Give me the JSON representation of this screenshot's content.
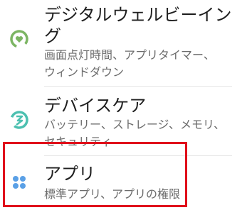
{
  "settings_list": {
    "items": [
      {
        "title": "デジタルウェルビーイング",
        "subtitle_lines": [
          "画面点灯時間、アプリタイマー、",
          "ウィンドダウン"
        ],
        "icon": "digital-wellbeing-icon",
        "icon_color": "#7cb563"
      },
      {
        "title": "デバイスケア",
        "subtitle_lines": [
          "バッテリー、ストレージ、メモリ、",
          "セキュリティ"
        ],
        "icon": "device-care-icon",
        "icon_color": "#4cc0b0"
      },
      {
        "title": "アプリ",
        "subtitle_lines": [
          "標準アプリ、アプリの権限"
        ],
        "icon": "apps-icon",
        "icon_color": "#5aa0e6"
      }
    ]
  },
  "highlight": {
    "color": "#e0101b",
    "target": "アプリ"
  }
}
